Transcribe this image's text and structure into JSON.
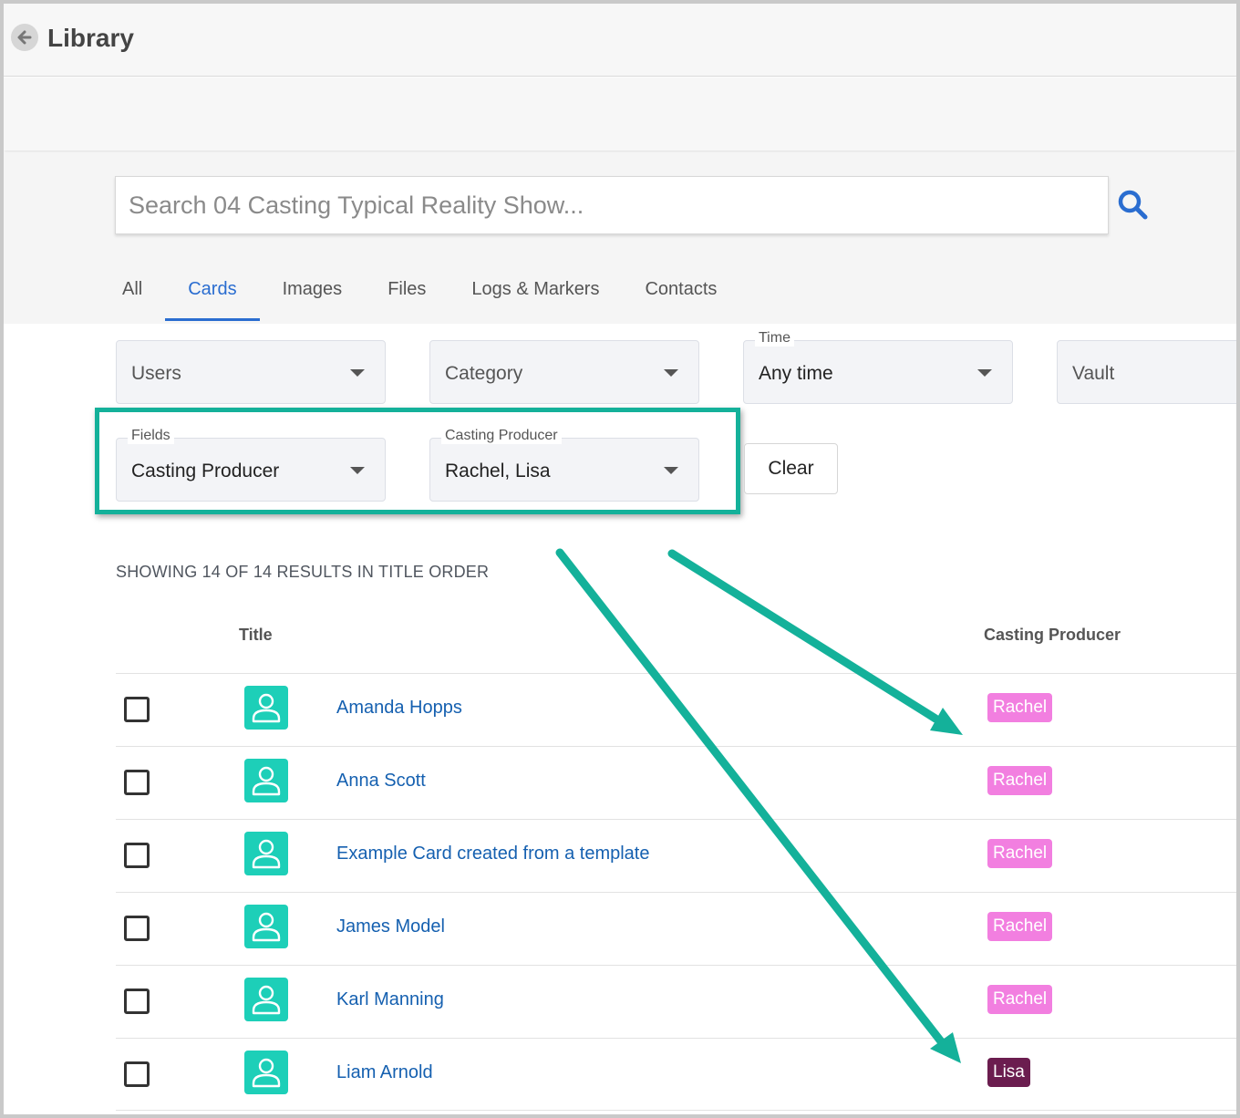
{
  "header": {
    "title": "Library"
  },
  "search": {
    "placeholder": "Search 04 Casting Typical Reality Show..."
  },
  "tabs": [
    {
      "label": "All",
      "active": false
    },
    {
      "label": "Cards",
      "active": true
    },
    {
      "label": "Images",
      "active": false
    },
    {
      "label": "Files",
      "active": false
    },
    {
      "label": "Logs & Markers",
      "active": false
    },
    {
      "label": "Contacts",
      "active": false
    }
  ],
  "filters": {
    "users": {
      "placeholder": "Users"
    },
    "category": {
      "placeholder": "Category"
    },
    "time": {
      "label": "Time",
      "value": "Any time"
    },
    "vault": {
      "placeholder": "Vault"
    },
    "fields": {
      "label": "Fields",
      "value": "Casting Producer"
    },
    "casting_producer": {
      "label": "Casting Producer",
      "value": "Rachel, Lisa"
    },
    "clear_label": "Clear"
  },
  "results": {
    "summary": "SHOWING 14 OF 14 RESULTS IN TITLE ORDER",
    "columns": {
      "title": "Title",
      "producer": "Casting Producer"
    },
    "rows": [
      {
        "title": "Amanda Hopps",
        "producer": "Rachel"
      },
      {
        "title": "Anna Scott",
        "producer": "Rachel"
      },
      {
        "title": "Example Card created from a template",
        "producer": "Rachel"
      },
      {
        "title": "James Model",
        "producer": "Rachel"
      },
      {
        "title": "Karl Manning",
        "producer": "Rachel"
      },
      {
        "title": "Liam Arnold",
        "producer": "Lisa"
      }
    ]
  },
  "colors": {
    "accent": "#2a6dd0",
    "highlight": "#14b19a",
    "avatar": "#1dcfb8",
    "tag_rachel": "#f27fe0",
    "tag_lisa": "#6b1d4f"
  }
}
